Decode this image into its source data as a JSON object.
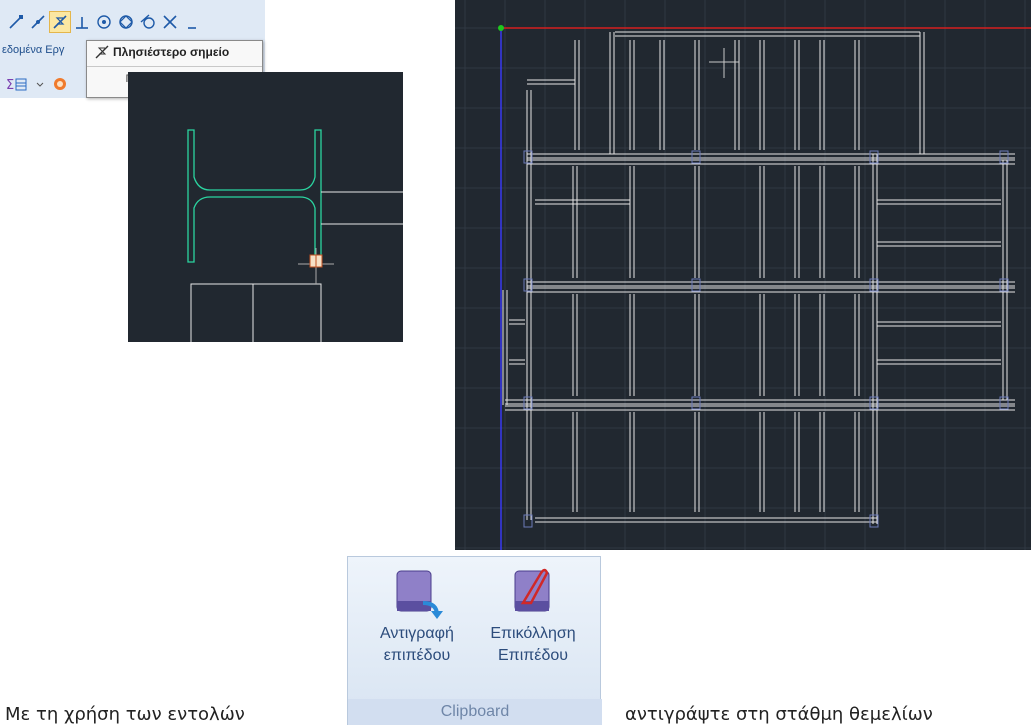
{
  "snap_toolbar": {
    "icons": [
      "endpoint-snap-icon",
      "midpoint-snap-icon",
      "nearest-snap-icon",
      "perpendicular-snap-icon",
      "center-snap-icon",
      "quadrant-snap-icon",
      "tangent-snap-icon",
      "intersection-snap-icon"
    ],
    "tab_label": "εδομένα Εργ",
    "tooltip_title": "Πλησιέστερο σημείο",
    "tooltip_description": "Πλησιέστερο σημείο"
  },
  "clipboard": {
    "copy_label_line1": "Αντιγραφή",
    "copy_label_line2": "επιπέδου",
    "paste_label_line1": "Επικόλληση",
    "paste_label_line2": "Επιπέδου",
    "group_label": "Clipboard"
  },
  "caption": {
    "before": "Με τη χρήση των εντολών",
    "after": "αντιγράψτε στη στάθμη θεμελίων"
  },
  "colors": {
    "cad_background": "#212830",
    "column_outline": "#2bd4a0",
    "x_axis": "#d61f1f",
    "y_axis": "#3a3aff",
    "origin": "#1ec81e"
  }
}
